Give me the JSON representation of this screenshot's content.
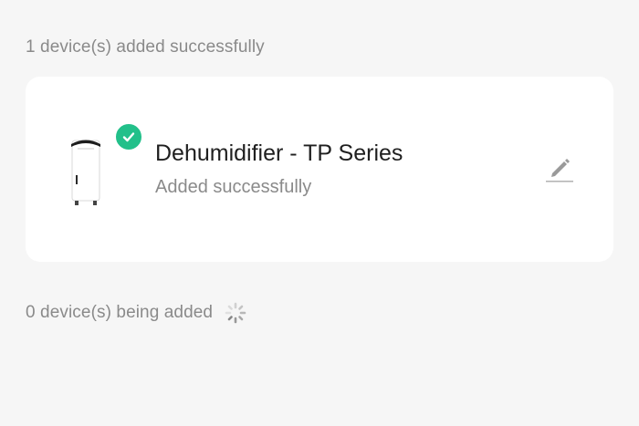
{
  "added_section": {
    "title": "1 device(s) added successfully"
  },
  "device": {
    "name": "Dehumidifier - TP Series",
    "status": "Added successfully",
    "badge_color": "#22c08a",
    "image_icon": "dehumidifier-image",
    "action_icon": "pencil-edit-icon"
  },
  "adding_section": {
    "title": "0 device(s) being added",
    "indicator_icon": "loading-spinner-icon"
  }
}
